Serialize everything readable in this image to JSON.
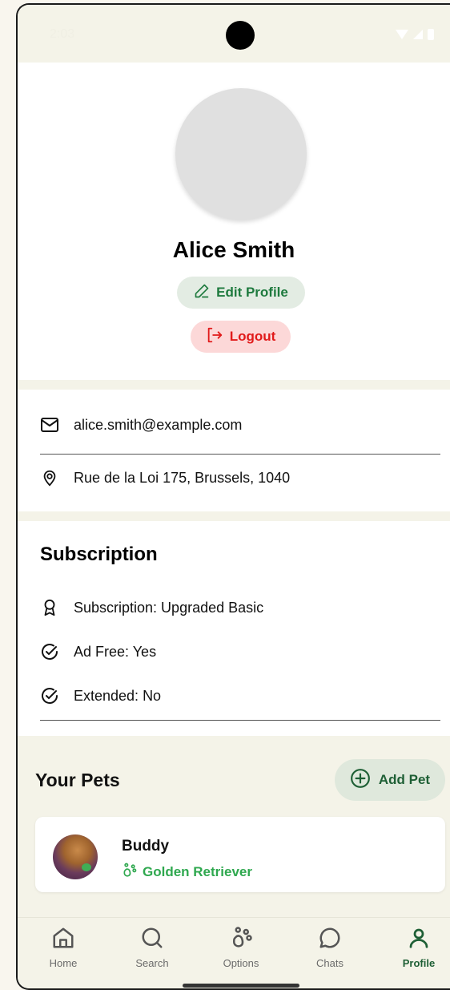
{
  "status_bar": {
    "time": "2:03"
  },
  "profile": {
    "name": "Alice Smith",
    "edit_label": "Edit Profile",
    "logout_label": "Logout"
  },
  "contact": {
    "email": "alice.smith@example.com",
    "address": "Rue de la Loi 175, Brussels, 1040"
  },
  "subscription": {
    "title": "Subscription",
    "plan": "Subscription: Upgraded Basic",
    "ad_free": "Ad Free: Yes",
    "extended": "Extended: No"
  },
  "pets": {
    "title": "Your Pets",
    "add_label": "Add Pet",
    "items": [
      {
        "name": "Buddy",
        "breed": "Golden Retriever"
      }
    ]
  },
  "nav": {
    "items": [
      {
        "label": "Home",
        "icon": "home-icon"
      },
      {
        "label": "Search",
        "icon": "search-icon"
      },
      {
        "label": "Options",
        "icon": "paw-icon"
      },
      {
        "label": "Chats",
        "icon": "chat-icon"
      },
      {
        "label": "Profile",
        "icon": "person-icon",
        "active": true
      }
    ]
  },
  "colors": {
    "accent_green": "#1e7a3e",
    "logout_red": "#e11b1b",
    "breed_green": "#2fa84f",
    "background": "#f4f3e8"
  }
}
